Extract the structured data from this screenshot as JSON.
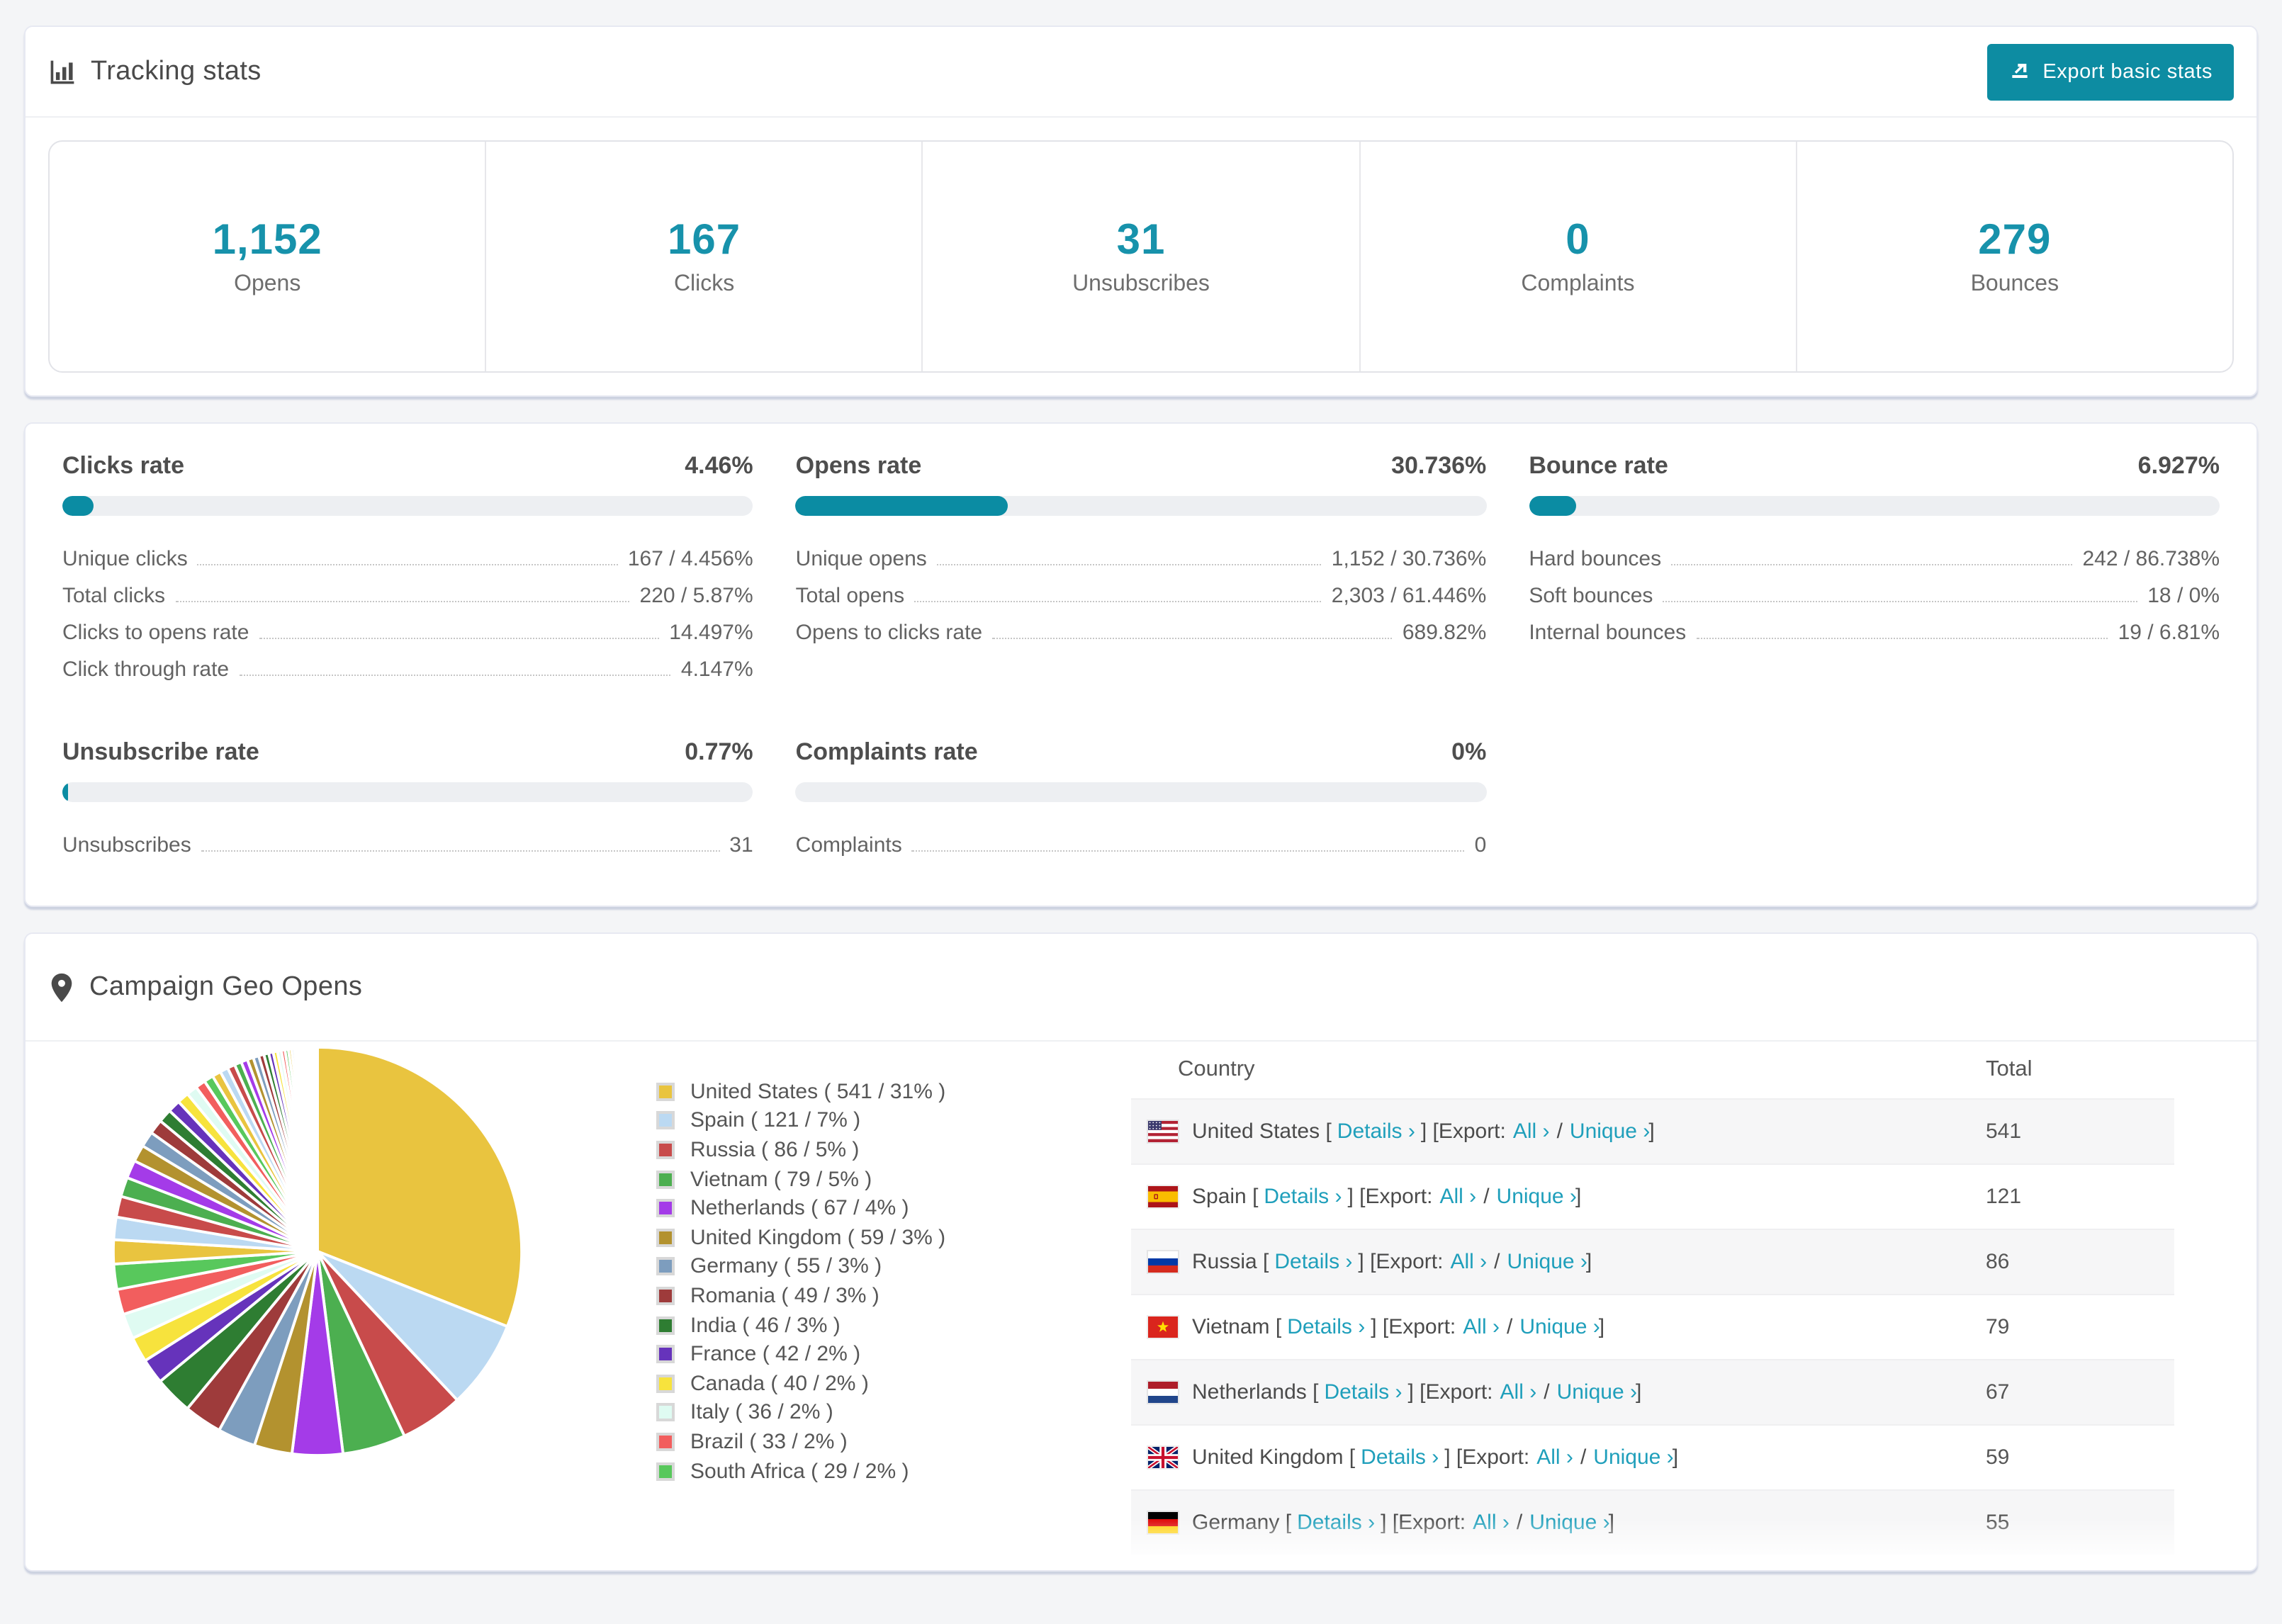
{
  "colors": {
    "accent": "#0d8ca2",
    "stat_number": "#1792ab",
    "link": "#1f9fbb"
  },
  "tracking": {
    "title": "Tracking stats",
    "export_button": "Export basic stats",
    "stats": [
      {
        "value": "1,152",
        "label": "Opens"
      },
      {
        "value": "167",
        "label": "Clicks"
      },
      {
        "value": "31",
        "label": "Unsubscribes"
      },
      {
        "value": "0",
        "label": "Complaints"
      },
      {
        "value": "279",
        "label": "Bounces"
      }
    ]
  },
  "rates": {
    "sections": [
      {
        "title": "Clicks rate",
        "value": "4.46%",
        "progress": 4.46,
        "rows": [
          {
            "label": "Unique clicks",
            "value": "167 / 4.456%"
          },
          {
            "label": "Total clicks",
            "value": "220 / 5.87%"
          },
          {
            "label": "Clicks to opens rate",
            "value": "14.497%"
          },
          {
            "label": "Click through rate",
            "value": "4.147%"
          }
        ]
      },
      {
        "title": "Opens rate",
        "value": "30.736%",
        "progress": 30.736,
        "rows": [
          {
            "label": "Unique opens",
            "value": "1,152 / 30.736%"
          },
          {
            "label": "Total opens",
            "value": "2,303 / 61.446%"
          },
          {
            "label": "Opens to clicks rate",
            "value": "689.82%"
          }
        ]
      },
      {
        "title": "Bounce rate",
        "value": "6.927%",
        "progress": 6.927,
        "rows": [
          {
            "label": "Hard bounces",
            "value": "242 / 86.738%"
          },
          {
            "label": "Soft bounces",
            "value": "18 / 0%"
          },
          {
            "label": "Internal bounces",
            "value": "19 / 6.81%"
          }
        ]
      },
      {
        "title": "Unsubscribe rate",
        "value": "0.77%",
        "progress": 0.77,
        "rows": [
          {
            "label": "Unsubscribes",
            "value": "31"
          }
        ]
      },
      {
        "title": "Complaints rate",
        "value": "0%",
        "progress": 0,
        "rows": [
          {
            "label": "Complaints",
            "value": "0"
          }
        ]
      }
    ]
  },
  "geo": {
    "title": "Campaign Geo Opens",
    "table": {
      "headers": [
        "Country",
        "Total"
      ],
      "details_label": "Details ›",
      "export_label": "Export:",
      "all_label": "All ›",
      "unique_label": "Unique ›",
      "rows": [
        {
          "country": "United States",
          "code": "us",
          "total": "541"
        },
        {
          "country": "Spain",
          "code": "es",
          "total": "121"
        },
        {
          "country": "Russia",
          "code": "ru",
          "total": "86"
        },
        {
          "country": "Vietnam",
          "code": "vn",
          "total": "79"
        },
        {
          "country": "Netherlands",
          "code": "nl",
          "total": "67"
        },
        {
          "country": "United Kingdom",
          "code": "gb",
          "total": "59"
        },
        {
          "country": "Germany",
          "code": "de",
          "total": "55",
          "partial": true
        }
      ]
    }
  },
  "chart_data": {
    "type": "pie",
    "title": "Campaign Geo Opens",
    "legend_position": "right",
    "slices": [
      {
        "label": "United States",
        "value": 541,
        "pct": 31,
        "color": "#E9C43F"
      },
      {
        "label": "Spain",
        "value": 121,
        "pct": 7,
        "color": "#BBD9F2"
      },
      {
        "label": "Russia",
        "value": 86,
        "pct": 5,
        "color": "#C84B4B"
      },
      {
        "label": "Vietnam",
        "value": 79,
        "pct": 5,
        "color": "#4CAF50"
      },
      {
        "label": "Netherlands",
        "value": 67,
        "pct": 4,
        "color": "#A43BE8"
      },
      {
        "label": "United Kingdom",
        "value": 59,
        "pct": 3,
        "color": "#B3922F"
      },
      {
        "label": "Germany",
        "value": 55,
        "pct": 3,
        "color": "#7D9DBE"
      },
      {
        "label": "Romania",
        "value": 49,
        "pct": 3,
        "color": "#9E3B3B"
      },
      {
        "label": "India",
        "value": 46,
        "pct": 3,
        "color": "#2E7D32"
      },
      {
        "label": "France",
        "value": 42,
        "pct": 2,
        "color": "#6633BB"
      },
      {
        "label": "Canada",
        "value": 40,
        "pct": 2,
        "color": "#F7E33D"
      },
      {
        "label": "Italy",
        "value": 36,
        "pct": 2,
        "color": "#DFFBF2"
      },
      {
        "label": "Brazil",
        "value": 33,
        "pct": 2,
        "color": "#F25E5E"
      },
      {
        "label": "South Africa",
        "value": 29,
        "pct": 2,
        "color": "#58C85C"
      }
    ],
    "others": {
      "total_pct": 26,
      "display_slices": 42,
      "note": "long tail of smaller countries, unlabeled thin slices"
    }
  }
}
